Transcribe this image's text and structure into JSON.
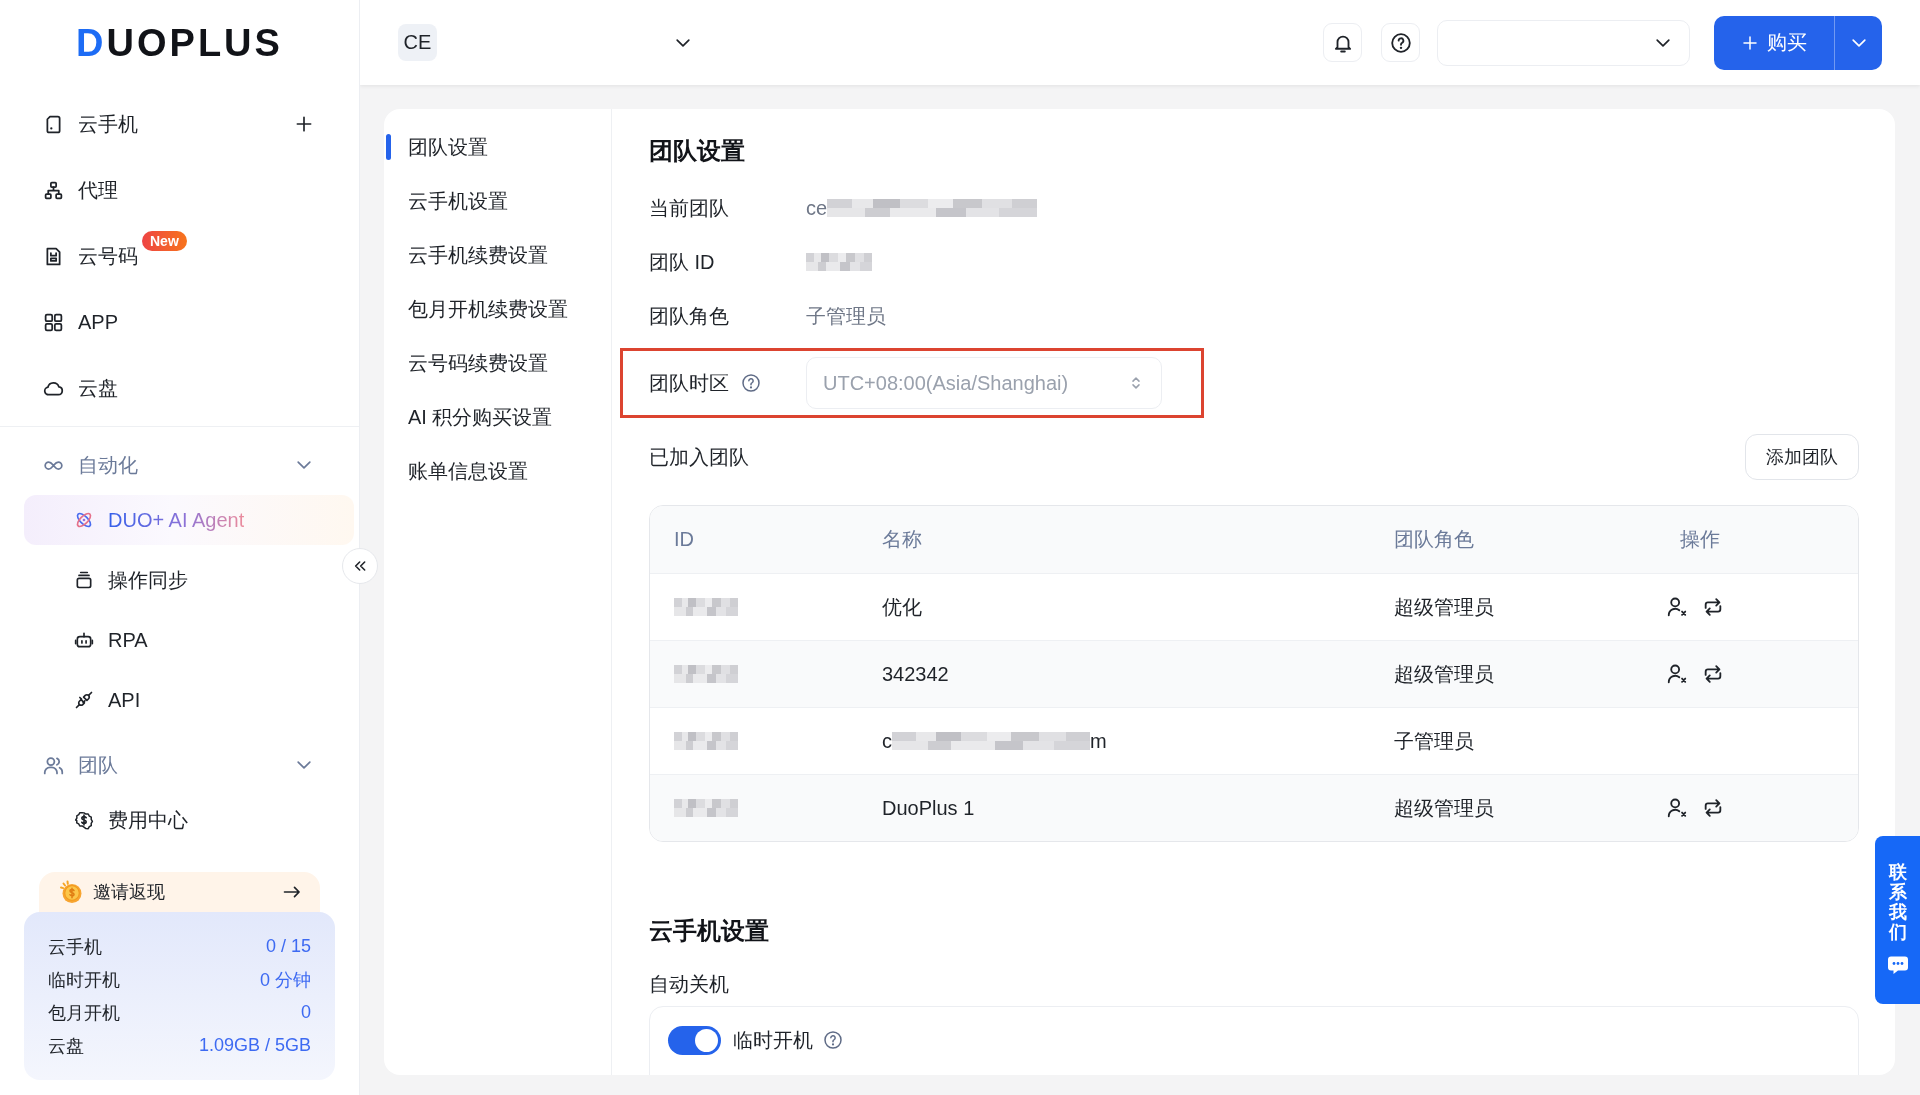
{
  "sidebar": {
    "logo": "DUOPLUS",
    "items": [
      {
        "label": "云手机"
      },
      {
        "label": "代理"
      },
      {
        "label": "云号码",
        "badge": "New"
      },
      {
        "label": "APP"
      },
      {
        "label": "云盘"
      }
    ],
    "groups": [
      {
        "label": "自动化",
        "expanded": true,
        "children": [
          {
            "label": "DUO+ AI Agent",
            "kind": "featured"
          },
          {
            "label": "操作同步",
            "kind": "plain"
          },
          {
            "label": "RPA",
            "kind": "plain"
          },
          {
            "label": "API",
            "kind": "plain"
          }
        ]
      },
      {
        "label": "团队",
        "expanded": true,
        "children": [
          {
            "label": "费用中心",
            "kind": "plain"
          }
        ]
      }
    ],
    "invite": {
      "label": "邀请返现"
    },
    "usage": [
      {
        "label": "云手机",
        "value": "0 / 15"
      },
      {
        "label": "临时开机",
        "value": "0 分钟"
      },
      {
        "label": "包月开机",
        "value": "0"
      },
      {
        "label": "云盘",
        "value": "1.09GB / 5GB"
      }
    ]
  },
  "header": {
    "team_badge": "CE",
    "buy_button": "购买"
  },
  "settings_nav": [
    {
      "label": "团队设置",
      "selected": true
    },
    {
      "label": "云手机设置",
      "selected": false
    },
    {
      "label": "云手机续费设置",
      "selected": false
    },
    {
      "label": "包月开机续费设置",
      "selected": false
    },
    {
      "label": "云号码续费设置",
      "selected": false
    },
    {
      "label": "AI 积分购买设置",
      "selected": false
    },
    {
      "label": "账单信息设置",
      "selected": false
    }
  ],
  "team_settings": {
    "title": "团队设置",
    "fields": [
      {
        "kind": "text",
        "label": "当前团队",
        "value": "ce",
        "redacted": true,
        "highlighted": false
      },
      {
        "kind": "text",
        "label": "团队 ID",
        "redacted": true,
        "highlighted": false
      },
      {
        "kind": "text",
        "label": "团队角色",
        "value": "子管理员",
        "redacted": false,
        "highlighted": false
      },
      {
        "kind": "select",
        "label": "团队时区",
        "value": "UTC+08:00(Asia/Shanghai)",
        "redacted": false,
        "highlighted": true
      }
    ]
  },
  "joined_teams": {
    "title": "已加入团队",
    "add_button": "添加团队",
    "columns": [
      "ID",
      "名称",
      "团队角色",
      "操作"
    ],
    "rows": [
      {
        "id_redacted": true,
        "name": "优化",
        "name_redacted": false,
        "role": "超级管理员",
        "actions": true
      },
      {
        "id_redacted": true,
        "name": "342342",
        "name_redacted": false,
        "role": "超级管理员",
        "actions": true
      },
      {
        "id_redacted": true,
        "name": "c",
        "name_redacted": true,
        "name_tail": "m",
        "role": "子管理员",
        "actions": false
      },
      {
        "id_redacted": true,
        "name": "DuoPlus 1",
        "name_redacted": false,
        "role": "超级管理员",
        "actions": true
      }
    ]
  },
  "cloud_phone_settings": {
    "title": "云手机设置",
    "subtitle": "自动关机",
    "toggle": {
      "label": "临时开机",
      "on": true
    }
  },
  "contact_tab": {
    "label": "联系我们"
  }
}
